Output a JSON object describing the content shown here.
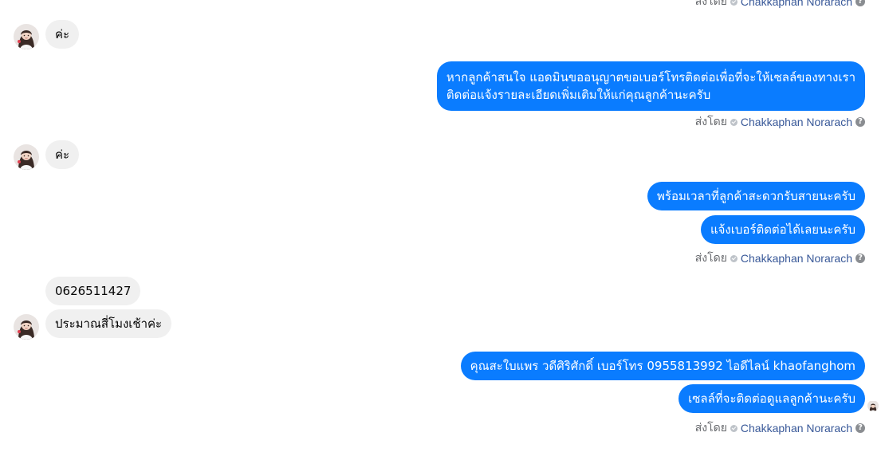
{
  "thread": {
    "sent_by_prefix": "ส่งโดย",
    "sender_name": "Chakkaphan Norarach",
    "help_glyph": "?",
    "messages": {
      "in1": "ค่ะ",
      "out1_line1": "หากลูกค้าสนใจ แอดมินขออนุญาตขอเบอร์โทรติดต่อเพื่อที่จะให้เซลล์ของทางเรา",
      "out1_line2": "ติดต่อแจ้งรายละเอียดเพิ่มเติมให้แก่คุณลูกค้านะครับ",
      "in2": "ค่ะ",
      "out2": "พร้อมเวลาที่ลูกค้าสะดวกรับสายนะครับ",
      "out3": "แจ้งเบอร์ติดต่อได้เลยนะครับ",
      "in3": "0626511427",
      "in4": "ประมาณสี่โมงเช้าค่ะ",
      "out4": "คุณสะใบแพร วดีศิริศักดิ์ เบอร์โทร 0955813992  ไอดีไลน์  khaofanghom",
      "out5": "เซลล์ที่จะติดต่อดูแลลูกค้านะครับ"
    }
  },
  "colors": {
    "outgoing_bubble": "#0a7cff",
    "incoming_bubble": "#f0f0f0",
    "sender_name": "#385898",
    "meta_text": "#65676b"
  },
  "icons": {
    "avatar": "user-avatar",
    "verified": "check-circle-icon",
    "help": "question-circle-icon"
  }
}
